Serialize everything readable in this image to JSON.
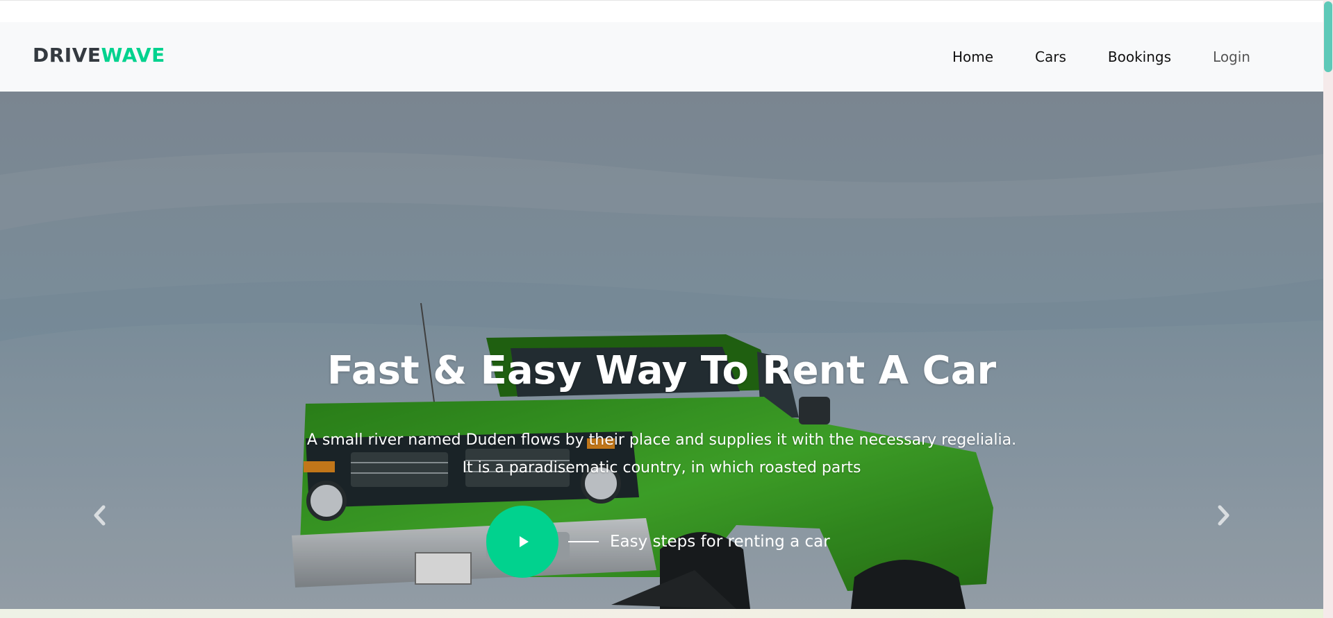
{
  "navbar": {
    "brand_primary": "DRIVE",
    "brand_accent": "WAVE",
    "links": [
      {
        "label": "Home"
      },
      {
        "label": "Cars"
      },
      {
        "label": "Bookings"
      },
      {
        "label": "Login"
      }
    ]
  },
  "hero": {
    "title": "Fast & Easy Way To Rent A Car",
    "subtitle_line1": "A small river named Duden flows by their place and supplies it with the necessary regelialia.",
    "subtitle_line2": "It is a paradisematic country, in which roasted parts",
    "video_label": "Easy steps for renting a car",
    "prev_icon": "chevron-left-icon",
    "next_icon": "chevron-right-icon",
    "play_icon": "play-icon"
  },
  "colors": {
    "accent": "#01d28e",
    "navbar_bg": "#f8f9fa",
    "brand_dark": "#343a40",
    "truck_green": "#3fae2b"
  }
}
